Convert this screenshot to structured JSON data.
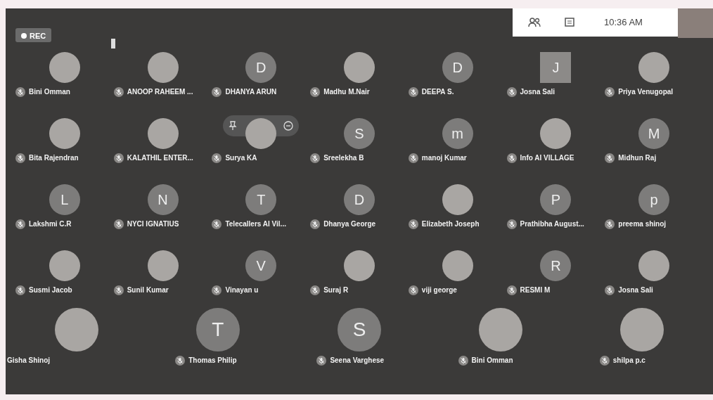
{
  "toolbar": {
    "recording": "REC",
    "time": "10:36 AM"
  },
  "grid": [
    {
      "name": "Bini Omman",
      "kind": "photo",
      "muted": true
    },
    {
      "name": "ANOOP RAHEEM ...",
      "kind": "photo",
      "muted": true
    },
    {
      "name": "DHANYA ARUN",
      "kind": "letter",
      "initial": "D",
      "muted": true
    },
    {
      "name": "Madhu M.Nair",
      "kind": "photo",
      "muted": true
    },
    {
      "name": "DEEPA S.",
      "kind": "letter",
      "initial": "D",
      "muted": true
    },
    {
      "name": "Josna Sali",
      "kind": "square",
      "initial": "J",
      "muted": true
    },
    {
      "name": "Priya Venugopal",
      "kind": "photo",
      "muted": true
    },
    {
      "name": "Bita Rajendran",
      "kind": "photo",
      "muted": true
    },
    {
      "name": "KALATHIL ENTER...",
      "kind": "photo",
      "muted": true
    },
    {
      "name": "Surya KA",
      "kind": "photo",
      "muted": true,
      "hovered": true
    },
    {
      "name": "Sreelekha B",
      "kind": "letter",
      "initial": "S",
      "muted": true
    },
    {
      "name": "manoj Kumar",
      "kind": "letter",
      "initial": "m",
      "muted": true
    },
    {
      "name": "Info AI VILLAGE",
      "kind": "photo",
      "muted": true
    },
    {
      "name": "Midhun Raj",
      "kind": "letter",
      "initial": "M",
      "muted": true
    },
    {
      "name": "Lakshmi C.R",
      "kind": "letter",
      "initial": "L",
      "muted": true
    },
    {
      "name": "NYCI IGNATIUS",
      "kind": "letter",
      "initial": "N",
      "muted": true
    },
    {
      "name": "Telecallers AI Vil...",
      "kind": "letter",
      "initial": "T",
      "muted": true
    },
    {
      "name": "Dhanya George",
      "kind": "letter",
      "initial": "D",
      "muted": true
    },
    {
      "name": "Elizabeth Joseph",
      "kind": "photo",
      "muted": true
    },
    {
      "name": "Prathibha August...",
      "kind": "letter",
      "initial": "P",
      "muted": true
    },
    {
      "name": "preema shinoj",
      "kind": "letter",
      "initial": "p",
      "muted": true
    },
    {
      "name": "Susmi Jacob",
      "kind": "photo",
      "muted": true
    },
    {
      "name": "Sunil Kumar",
      "kind": "photo",
      "muted": true
    },
    {
      "name": "Vinayan u",
      "kind": "letter",
      "initial": "V",
      "muted": true
    },
    {
      "name": "Suraj R",
      "kind": "photo",
      "muted": true
    },
    {
      "name": "viji george",
      "kind": "photo",
      "muted": true
    },
    {
      "name": "RESMI M",
      "kind": "letter",
      "initial": "R",
      "muted": true
    },
    {
      "name": "Josna Sali",
      "kind": "photo",
      "muted": true
    }
  ],
  "bottom_row": [
    {
      "name": "Gisha Shinoj",
      "kind": "photo",
      "muted": false
    },
    {
      "name": "Thomas Philip",
      "kind": "letter",
      "initial": "T",
      "muted": true
    },
    {
      "name": "Seena Varghese",
      "kind": "letter",
      "initial": "S",
      "muted": true
    },
    {
      "name": "Bini Omman",
      "kind": "photo",
      "muted": true
    },
    {
      "name": "shilpa p.c",
      "kind": "photo",
      "muted": true
    }
  ]
}
